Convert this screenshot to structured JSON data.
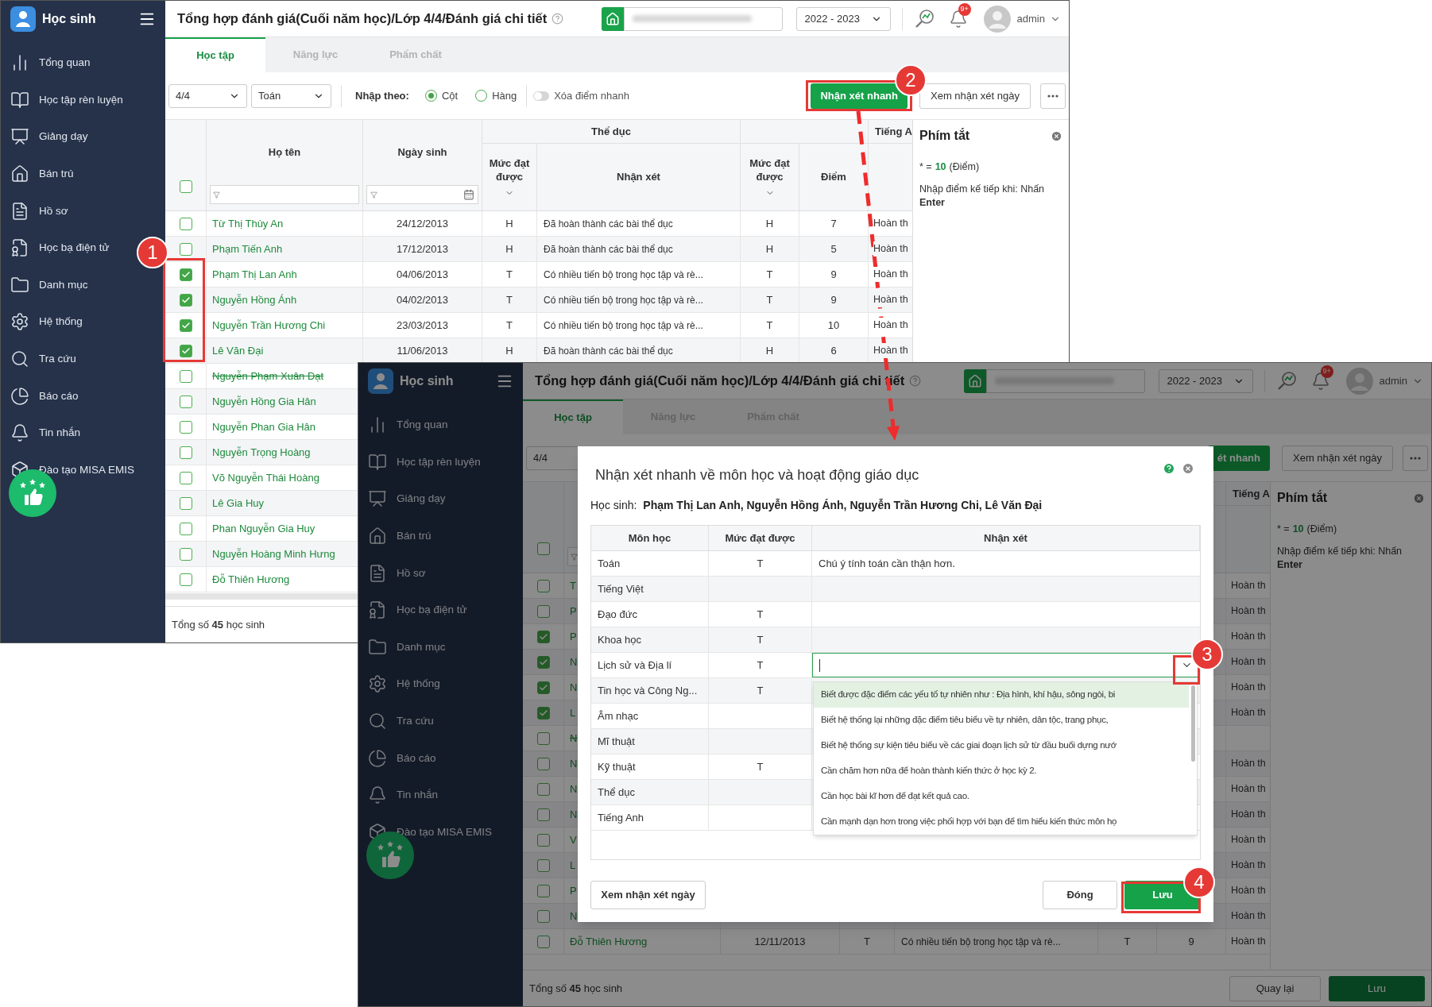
{
  "main_window": {
    "app_name": "Học sinh",
    "menu": [
      "Tổng quan",
      "Học tập rèn luyện",
      "Giảng dạy",
      "Bán trú",
      "Hồ sơ",
      "Học bạ điện tử",
      "Danh mục",
      "Hệ thống",
      "Tra cứu",
      "Báo cáo",
      "Tin nhắn",
      "Đào tạo MISA EMIS"
    ],
    "breadcrumb": "Tổng hợp đánh giá(Cuối năm học)/Lớp 4/4/Đánh giá chi tiết",
    "school_year": "2022 - 2023",
    "notifications": "9+",
    "user": "admin",
    "tabs": [
      {
        "label": "Học tập",
        "selected": true
      },
      {
        "label": "Năng lực",
        "selected": false
      },
      {
        "label": "Phẩm chất",
        "selected": false
      }
    ],
    "toolbar": {
      "class_select": "4/4",
      "subject_select": "Toán",
      "input_mode_label": "Nhập theo:",
      "input_modes": [
        {
          "label": "Cột",
          "selected": true
        },
        {
          "label": "Hàng",
          "selected": false
        }
      ],
      "quick_clear": {
        "label": "Xóa điểm nhanh",
        "on": false
      },
      "quick_comment_button": "Nhận xét nhanh",
      "daily_comments_button": "Xem nhận xét ngày"
    },
    "table": {
      "header": {
        "name": "Họ tên",
        "dob": "Ngày sinh",
        "group_1": "Thể dục",
        "level": "Mức đạt được",
        "comment": "Nhận xét",
        "level_2": "Mức đạt được",
        "score": "Điểm",
        "group_3": "Tiếng A"
      },
      "all_checked": false,
      "rows": [
        {
          "checked": false,
          "struck": false,
          "name": "Từ Thị Thùy An",
          "dob": "24/12/2013",
          "level": "H",
          "comment": "Đã hoàn thành các bài thể dục",
          "level_2": "H",
          "score": "7",
          "column_8": "Hoàn th"
        },
        {
          "checked": false,
          "struck": false,
          "name": "Phạm Tiến Anh",
          "dob": "17/12/2013",
          "level": "H",
          "comment": "Đã hoàn thành các bài thể dục",
          "level_2": "H",
          "score": "5",
          "column_8": "Hoàn th"
        },
        {
          "checked": true,
          "struck": false,
          "name": "Phạm Thị Lan Anh",
          "dob": "04/06/2013",
          "level": "T",
          "comment": "Có nhiều tiến bộ trong học tập và rè...",
          "level_2": "T",
          "score": "9",
          "column_8": "Hoàn th"
        },
        {
          "checked": true,
          "struck": false,
          "name": "Nguyễn Hồng Ánh",
          "dob": "04/02/2013",
          "level": "T",
          "comment": "Có nhiều tiến bộ trong học tập và rè...",
          "level_2": "T",
          "score": "9",
          "column_8": "Hoàn th"
        },
        {
          "checked": true,
          "struck": false,
          "name": "Nguyễn Trần Hương Chi",
          "dob": "23/03/2013",
          "level": "T",
          "comment": "Có nhiều tiến bộ trong học tập và rè...",
          "level_2": "T",
          "score": "10",
          "column_8": "Hoàn th"
        },
        {
          "checked": true,
          "struck": false,
          "name": "Lê Văn Đại",
          "dob": "11/06/2013",
          "level": "H",
          "comment": "Đã hoàn thành các bài thể dục",
          "level_2": "H",
          "score": "6",
          "column_8": "Hoàn th"
        },
        {
          "checked": false,
          "struck": true,
          "name": "Nguyễn Phạm Xuân Đạt"
        },
        {
          "checked": false,
          "struck": false,
          "name": "Nguyễn Hồng Gia Hân"
        },
        {
          "checked": false,
          "struck": false,
          "name": "Nguyễn Phan Gia Hân"
        },
        {
          "checked": false,
          "struck": false,
          "name": "Nguyễn Trọng Hoàng"
        },
        {
          "checked": false,
          "struck": false,
          "name": "Võ Nguyễn Thái Hoàng"
        },
        {
          "checked": false,
          "struck": false,
          "name": "Lê Gia Huy"
        },
        {
          "checked": false,
          "struck": false,
          "name": "Phan Nguyễn Gia Huy"
        },
        {
          "checked": false,
          "struck": false,
          "name": "Nguyễn Hoàng Minh Hưng"
        },
        {
          "checked": false,
          "struck": false,
          "name": "Đỗ Thiên Hương"
        }
      ]
    },
    "shortcuts": {
      "title": "Phím tắt",
      "prefix": "* =",
      "value": "10",
      "suffix": "(Điểm)",
      "hint": "Nhập điểm kế tiếp khi: Nhấn **Enter**"
    },
    "footer": {
      "summary": "Tổng số **45** học sinh"
    }
  },
  "dialog_window": {
    "app_name": "Học sinh",
    "menu": [
      "Tổng quan",
      "Học tập rèn luyện",
      "Giảng dạy",
      "Bán trú",
      "Hồ sơ",
      "Học bạ điện tử",
      "Danh mục",
      "Hệ thống",
      "Tra cứu",
      "Báo cáo",
      "Tin nhắn",
      "Đào tạo MISA EMIS"
    ],
    "breadcrumb": "Tổng hợp đánh giá(Cuối năm học)/Lớp 4/4/Đánh giá chi tiết",
    "school_year": "2022 - 2023",
    "notifications": "9+",
    "user": "admin",
    "tabs": [
      {
        "label": "Học tập",
        "selected": true
      },
      {
        "label": "Năng lực",
        "selected": false
      },
      {
        "label": "Phẩm chất",
        "selected": false
      }
    ],
    "toolbar": {
      "class_select": "4/4",
      "quick_comment_button": "ét nhanh",
      "daily_comments_button": "Xem nhận xét ngày"
    },
    "table": {
      "header": {
        "group_3": "Tiếng A"
      },
      "all_checked": false,
      "rows": [
        {
          "checked": false,
          "struck": false,
          "name": "T",
          "column_8": "Hoàn th"
        },
        {
          "checked": false,
          "struck": false,
          "name": "P",
          "column_8": "Hoàn th"
        },
        {
          "checked": true,
          "struck": false,
          "name": "P",
          "column_8": "Hoàn th"
        },
        {
          "checked": true,
          "struck": false,
          "name": "N",
          "column_8": "Hoàn th"
        },
        {
          "checked": true,
          "struck": false,
          "name": "N",
          "column_8": "Hoàn th"
        },
        {
          "checked": true,
          "struck": false,
          "name": "L",
          "column_8": "Hoàn th"
        },
        {
          "checked": false,
          "struck": true,
          "name": "N"
        },
        {
          "checked": false,
          "struck": false,
          "name": "N",
          "column_8": "Hoàn th"
        },
        {
          "checked": false,
          "struck": false,
          "name": "N",
          "column_8": "Hoàn th"
        },
        {
          "checked": false,
          "struck": false,
          "name": "N",
          "column_8": "Hoàn th"
        },
        {
          "checked": false,
          "struck": false,
          "name": "V",
          "column_8": "Hoàn th"
        },
        {
          "checked": false,
          "struck": false,
          "name": "L",
          "column_8": "Hoàn th"
        },
        {
          "checked": false,
          "struck": false,
          "name": "P",
          "column_8": "Hoàn th"
        },
        {
          "checked": false,
          "struck": false,
          "name": "N",
          "column_8": "Hoàn th"
        },
        {
          "checked": false,
          "struck": false,
          "name": "Đỗ Thiên Hương",
          "dob": "12/11/2013",
          "level": "T",
          "comment": "Có nhiều tiến bộ trong học tập và rè...",
          "level_2": "T",
          "score": "9",
          "column_8": "Hoàn th"
        }
      ]
    },
    "shortcuts": {
      "title": "Phím tắt",
      "prefix": "* =",
      "value": "10",
      "suffix": "(Điểm)",
      "hint": "Nhập điểm kế tiếp khi: Nhấn **Enter**"
    },
    "footer": {
      "summary": "Tổng số **45** học sinh",
      "back_button": "Quay lại",
      "save_button": "Lưu"
    },
    "modal": {
      "title": "Nhận xét nhanh về môn học và hoạt động giáo dục",
      "students_label": "Học sinh:",
      "students": "Phạm Thị Lan Anh, Nguyễn Hồng Ánh, Nguyễn Trần Hương Chi, Lê Văn Đại",
      "columns": [
        "Môn học",
        "Mức đạt được",
        "Nhận xét"
      ],
      "rows": [
        {
          "kind": "text",
          "subject": "Toán",
          "level": "T",
          "comment": "Chú ý tính toán cần thận hơn."
        },
        {
          "kind": "text",
          "subject": "Tiếng Việt"
        },
        {
          "kind": "text",
          "subject": "Đạo đức",
          "level": "T"
        },
        {
          "kind": "text",
          "subject": "Khoa học",
          "level": "T"
        },
        {
          "kind": "input",
          "subject": "Lịch sử và Địa lí",
          "level": "T"
        },
        {
          "kind": "text",
          "subject": "Tin học và Công Ng...",
          "level": "T"
        },
        {
          "kind": "text",
          "subject": "Âm nhạc"
        },
        {
          "kind": "text",
          "subject": "Mĩ thuật"
        },
        {
          "kind": "text",
          "subject": "Kỹ thuật",
          "level": "T"
        },
        {
          "kind": "text",
          "subject": "Thể dục"
        },
        {
          "kind": "text",
          "subject": "Tiếng Anh"
        }
      ],
      "options": [
        {
          "label": "Biết được đặc điểm các yếu tố tự nhiên như : Địa hình, khí hậu, sông ngòi, bi",
          "highlighted": true
        },
        {
          "label": "Biết hệ thống lại những đặc điểm tiêu biểu về tự nhiên, dân tộc, trang phục,",
          "highlighted": false
        },
        {
          "label": "Biết hệ thống sự kiện tiêu biểu về các giai đoạn lịch sử từ đầu buổi dựng nướ",
          "highlighted": false
        },
        {
          "label": "Cần chăm hơn nữa để hoàn thành kiến thức ở học kỳ 2.",
          "highlighted": false
        },
        {
          "label": "Cần học bài kĩ hơn để đạt kết quả cao.",
          "highlighted": false
        },
        {
          "label": "Cần mạnh dạn hơn trong việc phối hợp với bạn để tìm hiểu kiến thức môn họ",
          "highlighted": false
        }
      ],
      "daily_comments_button": "Xem nhận xét ngày",
      "close_button": "Đóng",
      "save_button": "Lưu"
    }
  },
  "annotations": [
    {
      "label": "1"
    },
    {
      "label": "2"
    },
    {
      "label": "3"
    },
    {
      "label": "4"
    }
  ]
}
